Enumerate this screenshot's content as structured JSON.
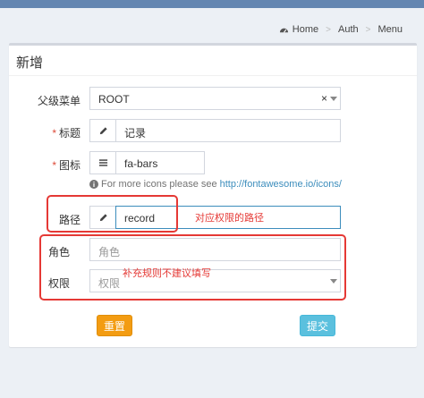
{
  "breadcrumb": {
    "home": "Home",
    "auth": "Auth",
    "menu": "Menu",
    "separator": ">"
  },
  "form": {
    "title": "新增",
    "parent": {
      "label": "父级菜单",
      "value": "ROOT",
      "clear": "×"
    },
    "title_field": {
      "required": "*",
      "label": "标题",
      "value": "记录",
      "icon": "pencil-icon"
    },
    "icon_field": {
      "required": "*",
      "label": "图标",
      "value": "fa-bars",
      "icon": "bars-icon",
      "help_text": "For more icons please see",
      "help_link": "http://fontawesome.io/icons/"
    },
    "path_field": {
      "label": "路径",
      "value": "record",
      "icon": "pencil-icon"
    },
    "role_field": {
      "label": "角色",
      "placeholder": "角色"
    },
    "permission_field": {
      "label": "权限",
      "placeholder": "权限"
    },
    "reset_label": "重置",
    "submit_label": "提交"
  },
  "annotations": {
    "path_note": "对应权限的路径",
    "rules_note": "补充规则不建议填写",
    "color": "#e53935"
  }
}
